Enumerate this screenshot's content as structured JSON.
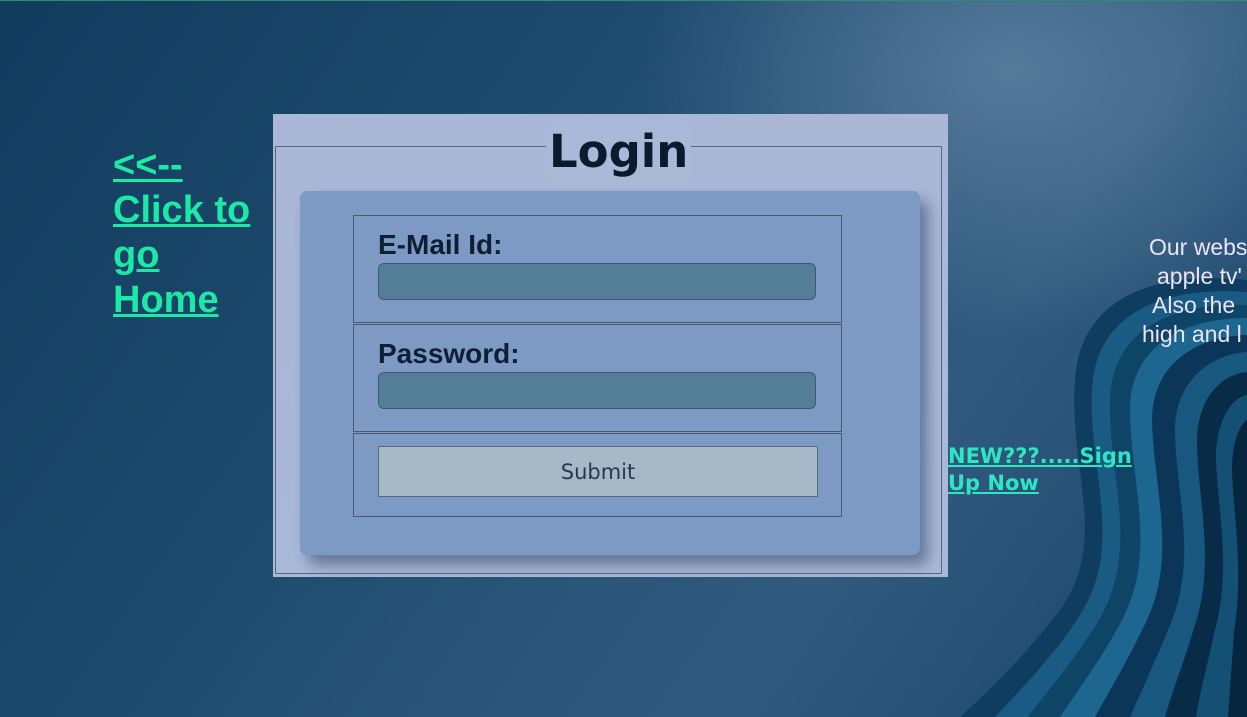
{
  "home_link": {
    "lines": [
      "<<--",
      "Click to",
      "go",
      "Home"
    ]
  },
  "login": {
    "title": "Login",
    "email_label": "E-Mail Id:",
    "email_value": "",
    "password_label": "Password:",
    "password_value": "",
    "submit_label": "Submit"
  },
  "signup_link": {
    "line1": "NEW???.....Sign",
    "line2": "Up Now"
  },
  "description": {
    "lines": [
      "Our webs",
      "apple tv'",
      "Also the",
      "high and l"
    ]
  },
  "colors": {
    "link_home": "#1de9a6",
    "link_signup": "#2fe6c4",
    "panel": "#aab7d7",
    "card": "#7d9ac4",
    "input": "#547e98"
  }
}
